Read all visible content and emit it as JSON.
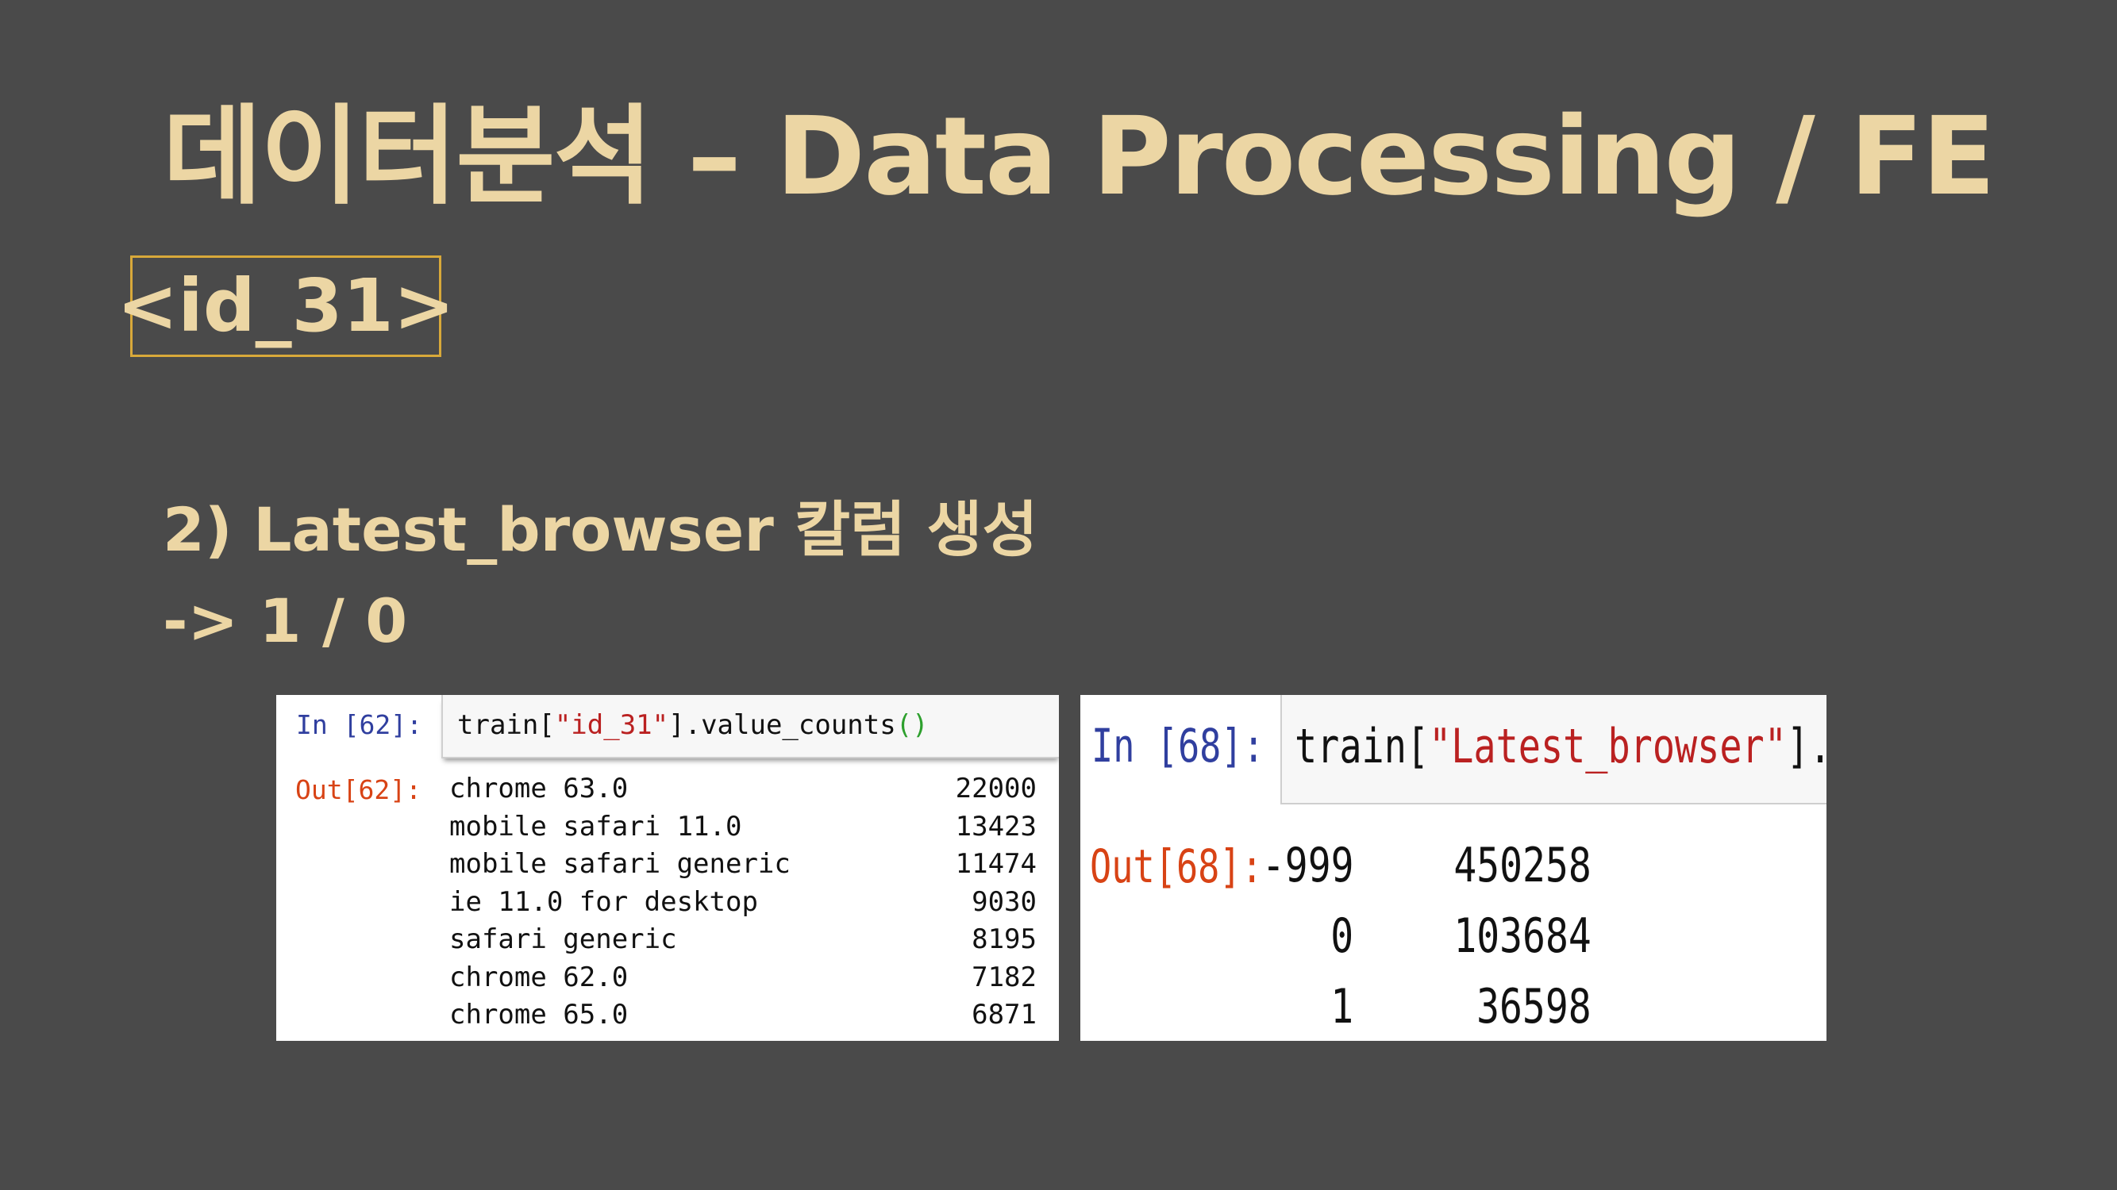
{
  "slide": {
    "title": "데이터분석 – Data Processing / FE",
    "tag": "<id_31>",
    "subtitle_line1": "2) Latest_browser 칼럼 생성",
    "subtitle_line2": "-> 1 / 0"
  },
  "colors": {
    "background": "#4a4a4a",
    "title_text": "#ecd6a4",
    "tag_border": "#d8a93a",
    "in_prompt": "#303f9f",
    "out_prompt": "#d84315",
    "string_literal": "#ba2121",
    "parentheses": "#2ea02e"
  },
  "notebook_cell_1": {
    "in_prompt": "In [62]:",
    "code_prefix": "train[",
    "code_string": "\"id_31\"",
    "code_suffix": "].value_counts",
    "code_parens": "()",
    "out_prompt": "Out[62]:",
    "rows": [
      {
        "label": "chrome 63.0",
        "count": "22000"
      },
      {
        "label": "mobile safari 11.0",
        "count": "13423"
      },
      {
        "label": "mobile safari generic",
        "count": "11474"
      },
      {
        "label": "ie 11.0 for desktop",
        "count": "9030"
      },
      {
        "label": "safari generic",
        "count": "8195"
      },
      {
        "label": "chrome 62.0",
        "count": "7182"
      },
      {
        "label": "chrome 65.0",
        "count": "6871"
      }
    ]
  },
  "notebook_cell_2": {
    "in_prompt": "In [68]:",
    "code_prefix": "train[",
    "code_string": "\"Latest_browser\"",
    "code_suffix": "].v",
    "out_prompt": "Out[68]:",
    "rows": [
      {
        "label": "-999",
        "count": "450258"
      },
      {
        "label": "0",
        "count": "103684"
      },
      {
        "label": "1",
        "count": "36598"
      }
    ]
  }
}
